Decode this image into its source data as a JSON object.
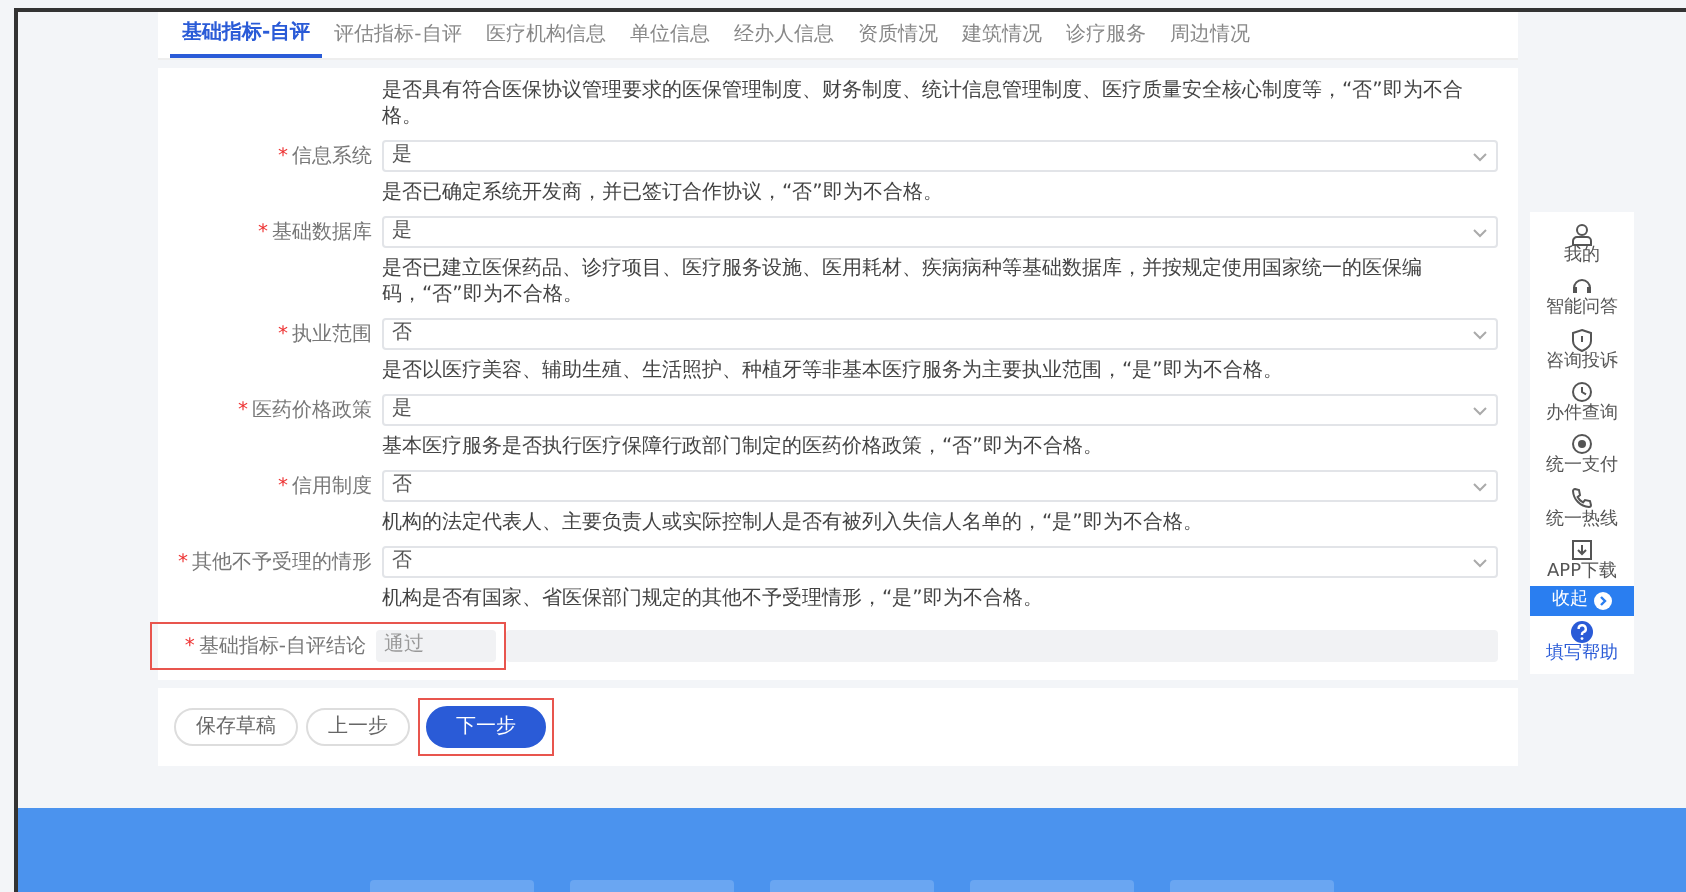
{
  "tabs": [
    {
      "label": "基础指标-自评",
      "selected": true
    },
    {
      "label": "评估指标-自评",
      "selected": false
    },
    {
      "label": "医疗机构信息",
      "selected": false
    },
    {
      "label": "单位信息",
      "selected": false
    },
    {
      "label": "经办人信息",
      "selected": false
    },
    {
      "label": "资质情况",
      "selected": false
    },
    {
      "label": "建筑情况",
      "selected": false
    },
    {
      "label": "诊疗服务",
      "selected": false
    },
    {
      "label": "周边情况",
      "selected": false
    }
  ],
  "intro": "是否具有符合医保协议管理要求的医保管理制度、财务制度、统计信息管理制度、医疗质量安全核心制度等，“否”即为不合格。",
  "fields": [
    {
      "mark": "*",
      "label": "信息系统",
      "value": "是",
      "description": "是否已确定系统开发商，并已签订合作协议，“否”即为不合格。"
    },
    {
      "mark": "*",
      "label": "基础数据库",
      "value": "是",
      "description": "是否已建立医保药品、诊疗项目、医疗服务设施、医用耗材、疾病病种等基础数据库，并按规定使用国家统一的医保编码，“否”即为不合格。"
    },
    {
      "mark": "*",
      "label": "执业范围",
      "value": "否",
      "description": "是否以医疗美容、辅助生殖、生活照护、种植牙等非基本医疗服务为主要执业范围，“是”即为不合格。"
    },
    {
      "mark": "*",
      "label": "医药价格政策",
      "value": "是",
      "description": "基本医疗服务是否执行医疗保障行政部门制定的医药价格政策，“否”即为不合格。"
    },
    {
      "mark": "*",
      "label": "信用制度",
      "value": "否",
      "description": "机构的法定代表人、主要负责人或实际控制人是否有被列入失信人名单的，“是”即为不合格。"
    },
    {
      "mark": "*",
      "label": "其他不予受理的情形",
      "value": "否",
      "description": "机构是否有国家、省医保部门规定的其他不予受理情形，“是”即为不合格。"
    }
  ],
  "conclusion": {
    "mark": "*",
    "label": "基础指标-自评结论",
    "value": "通过",
    "disabled": true,
    "highlighted": true
  },
  "buttons": [
    {
      "label": "保存草稿",
      "kind": "outline",
      "highlighted": false
    },
    {
      "label": "上一步",
      "kind": "outline",
      "highlighted": false
    },
    {
      "label": "下一步",
      "kind": "primary",
      "highlighted": true
    }
  ],
  "sidebar": [
    {
      "label": "我的",
      "kind": "item"
    },
    {
      "label": "智能问答",
      "kind": "item"
    },
    {
      "label": "咨询投诉",
      "kind": "item"
    },
    {
      "label": "办件查询",
      "kind": "item"
    },
    {
      "label": "统一支付",
      "kind": "item"
    },
    {
      "label": "统一热线",
      "kind": "item"
    },
    {
      "label": "APP下载",
      "kind": "item"
    },
    {
      "label": "收起",
      "kind": "collapse"
    },
    {
      "label": "填写帮助",
      "kind": "help"
    }
  ]
}
